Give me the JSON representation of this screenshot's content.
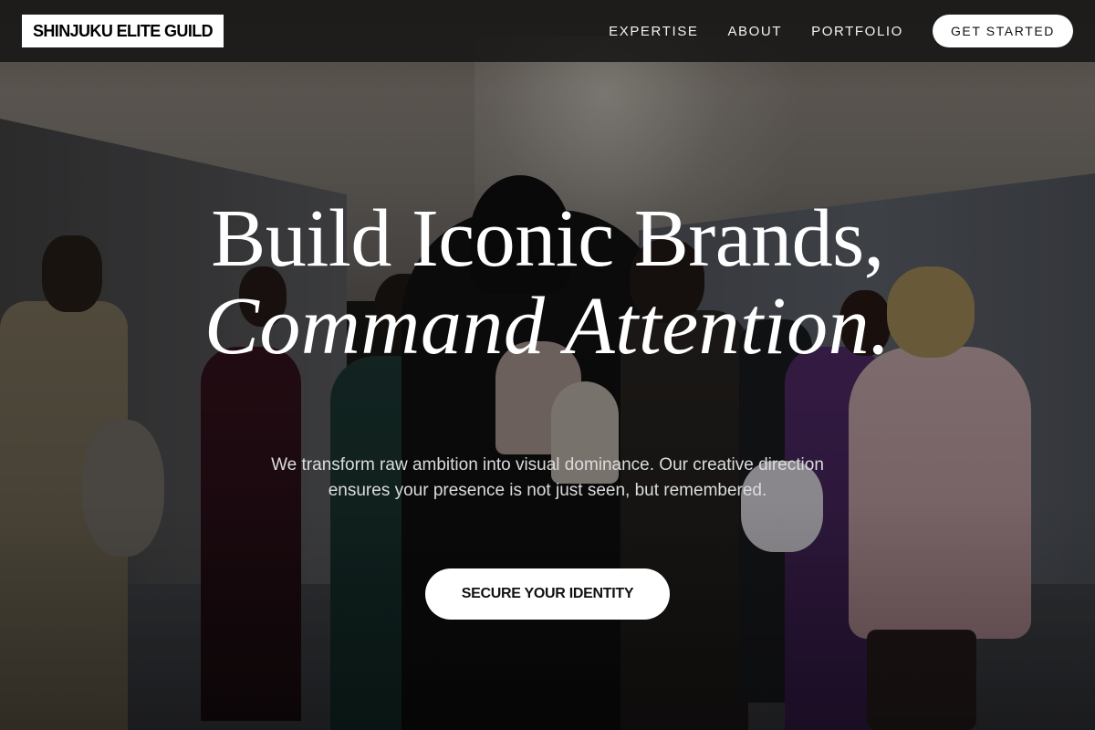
{
  "brand": {
    "logo_text": "SHINJUKU ELITE GUILD"
  },
  "nav": {
    "items": [
      {
        "label": "EXPERTISE"
      },
      {
        "label": "ABOUT"
      },
      {
        "label": "PORTFOLIO"
      }
    ],
    "cta_label": "GET STARTED"
  },
  "hero": {
    "headline_line1": "Build Iconic Brands,",
    "headline_line2": "Command Attention.",
    "subtext": "We transform raw ambition into visual dominance. Our creative direction ensures your presence is not just seen, but remembered.",
    "cta_label": "SECURE YOUR IDENTITY"
  },
  "colors": {
    "header_bg": "#181716",
    "logo_bg": "#ffffff",
    "text_light": "#ffffff",
    "button_bg": "#ffffff",
    "button_text": "#111111"
  }
}
